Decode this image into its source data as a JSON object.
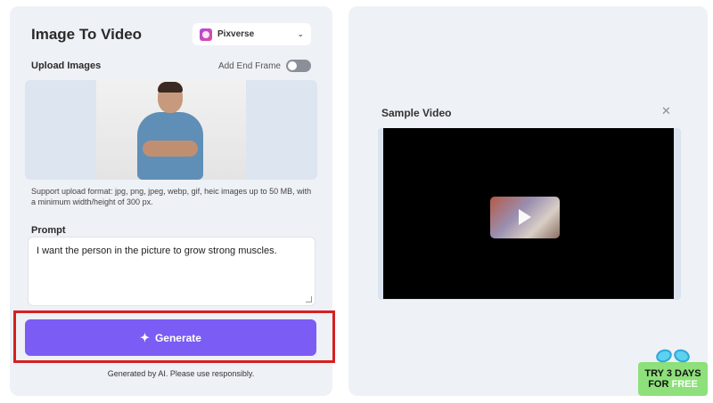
{
  "left_panel": {
    "title": "Image To Video",
    "model_select": {
      "value": "Pixverse"
    },
    "upload": {
      "label": "Upload Images",
      "end_frame_label": "Add End Frame",
      "end_frame_enabled": false,
      "hint": "Support upload format: jpg, png, jpeg, webp, gif, heic images up to 50 MB, with a minimum width/height of 300 px."
    },
    "prompt": {
      "label": "Prompt",
      "value": "I want the person in the picture to grow strong muscles."
    },
    "generate_label": "Generate",
    "disclaimer": "Generated by AI. Please use responsibly."
  },
  "right_panel": {
    "sample_title": "Sample Video"
  },
  "promo": {
    "line1": "TRY 3 DAYS",
    "line2_prefix": "FOR ",
    "line2_highlight": "FREE"
  },
  "colors": {
    "accent": "#7b5cf5",
    "highlight_border": "#d62020",
    "panel_bg": "#eef1f6"
  },
  "icons": {
    "model": "pixverse-logo-icon",
    "chevron": "chevron-down-icon",
    "generate": "sparkle-icon",
    "close": "close-icon",
    "play": "play-icon"
  }
}
